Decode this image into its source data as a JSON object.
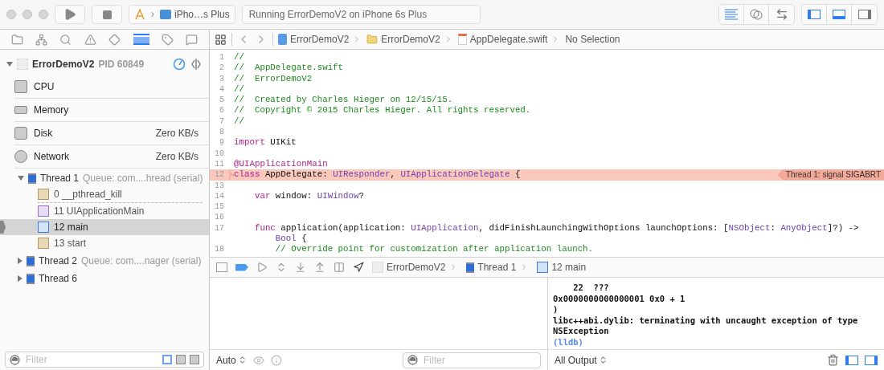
{
  "toolbar": {
    "scheme": "iPho…s Plus",
    "activity": "Running ErrorDemoV2 on iPhone 6s Plus",
    "editor_modes": [
      {
        "kind": "standard",
        "selected": true
      },
      {
        "kind": "assistant",
        "selected": false
      },
      {
        "kind": "version",
        "selected": false
      }
    ],
    "panels": [
      {
        "kind": "navigator",
        "on": true
      },
      {
        "kind": "debug",
        "on": true
      },
      {
        "kind": "utilities",
        "on": false
      }
    ]
  },
  "navigator_tabs": [
    {
      "kind": "folder",
      "selected": false
    },
    {
      "kind": "hierarchy",
      "selected": false
    },
    {
      "kind": "search",
      "selected": false
    },
    {
      "kind": "warning",
      "selected": false
    },
    {
      "kind": "test",
      "selected": false
    },
    {
      "kind": "debug",
      "selected": true
    },
    {
      "kind": "breakpoint",
      "selected": false
    },
    {
      "kind": "report",
      "selected": false
    }
  ],
  "process": {
    "name": "ErrorDemoV2",
    "pid": "PID 60849",
    "expanded": true
  },
  "gauges": [
    {
      "kind": "cpu",
      "label": "CPU"
    },
    {
      "kind": "memory",
      "label": "Memory"
    },
    {
      "kind": "disk",
      "label": "Disk",
      "value": "Zero KB/s"
    },
    {
      "kind": "network",
      "label": "Network",
      "value": "Zero KB/s"
    }
  ],
  "threads": [
    {
      "name": "Thread 1",
      "queue": "Queue: com....hread (serial)",
      "expanded": true,
      "children": [
        {
          "kind": "system",
          "label": "0 __pthread_kill",
          "selected": false,
          "gap_after": true
        },
        {
          "kind": "framework",
          "label": "11 UIApplicationMain",
          "selected": false,
          "gap_after": false
        },
        {
          "kind": "user",
          "label": "12 main",
          "selected": true,
          "gap_after": false
        },
        {
          "kind": "system",
          "label": "13 start",
          "selected": false,
          "gap_after": false
        }
      ]
    },
    {
      "name": "Thread 2",
      "queue": "Queue: com....nager (serial)",
      "expanded": false
    },
    {
      "name": "Thread 6",
      "expanded": false
    }
  ],
  "navigator_filter": {
    "placeholder": "Filter"
  },
  "jump_bar": [
    "ErrorDemoV2",
    "ErrorDemoV2",
    "AppDelegate.swift",
    "No Selection"
  ],
  "code": [
    {
      "n": "1",
      "t": [
        {
          "kind": "comment",
          "text": "//"
        }
      ]
    },
    {
      "n": "2",
      "t": [
        {
          "kind": "comment",
          "text": "//  AppDelegate.swift"
        }
      ]
    },
    {
      "n": "3",
      "t": [
        {
          "kind": "comment",
          "text": "//  ErrorDemoV2"
        }
      ]
    },
    {
      "n": "4",
      "t": [
        {
          "kind": "comment",
          "text": "//"
        }
      ]
    },
    {
      "n": "5",
      "t": [
        {
          "kind": "comment",
          "text": "//  Created by Charles Hieger on 12/15/15."
        }
      ]
    },
    {
      "n": "6",
      "t": [
        {
          "kind": "comment",
          "text": "//  Copyright © 2015 Charles Hieger. All rights reserved."
        }
      ]
    },
    {
      "n": "7",
      "t": [
        {
          "kind": "comment",
          "text": "//"
        }
      ]
    },
    {
      "n": "8"
    },
    {
      "n": "9",
      "t": [
        {
          "kind": "keyword",
          "text": "import"
        },
        {
          "kind": "plain",
          "text": " UIKit"
        }
      ]
    },
    {
      "n": "10"
    },
    {
      "n": "11",
      "t": [
        {
          "kind": "keyword",
          "text": "@UIApplicationMain"
        }
      ]
    },
    {
      "n": "12",
      "t": [
        {
          "kind": "keyword",
          "text": "class"
        },
        {
          "kind": "plain",
          "text": " AppDelegate: "
        },
        {
          "kind": "type",
          "text": "UIResponder"
        },
        {
          "kind": "plain",
          "text": ", "
        },
        {
          "kind": "type",
          "text": "UIApplicationDelegate"
        },
        {
          "kind": "plain",
          "text": " {"
        }
      ],
      "annotation": "Thread 1: signal SIGABRT"
    },
    {
      "n": "13"
    },
    {
      "n": "14",
      "t": [
        {
          "kind": "keyword",
          "text": "    var"
        },
        {
          "kind": "plain",
          "text": " window: "
        },
        {
          "kind": "type",
          "text": "UIWindow"
        },
        {
          "kind": "plain",
          "text": "?"
        }
      ]
    },
    {
      "n": "15"
    },
    {
      "n": "16"
    },
    {
      "n": "17",
      "t": [
        {
          "kind": "keyword",
          "text": "    func"
        },
        {
          "kind": "plain",
          "text": " application(application: "
        },
        {
          "kind": "type",
          "text": "UIApplication"
        },
        {
          "kind": "plain",
          "text": ", didFinishLaunchingWithOptions launchOptions: ["
        },
        {
          "kind": "type",
          "text": "NSObject"
        },
        {
          "kind": "plain",
          "text": ": "
        },
        {
          "kind": "type",
          "text": "AnyObject"
        },
        {
          "kind": "plain",
          "text": "]?) ->"
        }
      ],
      "wrap": [
        {
          "kind": "type",
          "text": "        Bool"
        },
        {
          "kind": "plain",
          "text": " {"
        }
      ]
    },
    {
      "n": "18",
      "t": [
        {
          "kind": "comment",
          "text": "        // Override point for customization after application launch."
        }
      ]
    }
  ],
  "debug_bar": {
    "breakpoints_active": true,
    "path": [
      "ErrorDemoV2",
      "Thread 1",
      "12 main"
    ]
  },
  "variables": {
    "scope": "Auto",
    "filter_placeholder": "Filter"
  },
  "console": {
    "lines": [
      {
        "kind": "output",
        "text": "    22  ???"
      },
      {
        "kind": "output",
        "text": "0x0000000000000001 0x0 + 1"
      },
      {
        "kind": "output",
        "text": ")"
      },
      {
        "kind": "output",
        "text": "libc++abi.dylib: terminating with uncaught exception of type NSException"
      },
      {
        "kind": "prompt",
        "text": "(lldb)"
      }
    ],
    "output": "All Output"
  }
}
